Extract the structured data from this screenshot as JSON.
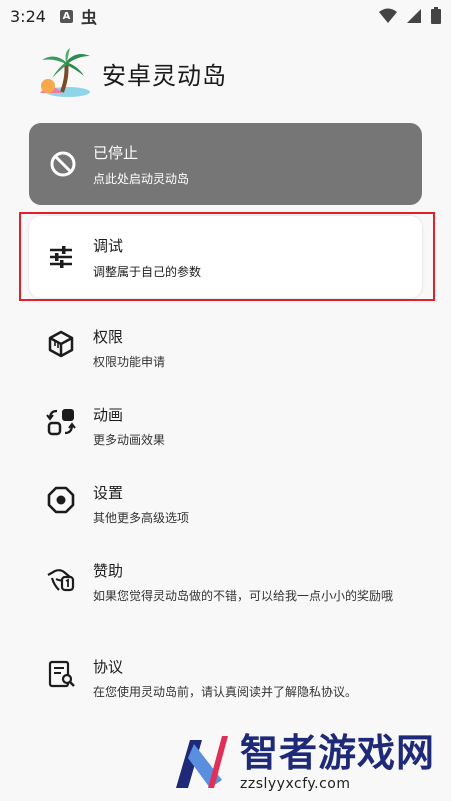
{
  "status_bar": {
    "time": "3:24",
    "notif_a": "A",
    "notif_bug": "虫"
  },
  "app": {
    "title": "安卓灵动岛"
  },
  "cards": {
    "stopped": {
      "title": "已停止",
      "subtitle": "点此处启动灵动岛"
    },
    "debug": {
      "title": "调试",
      "subtitle": "调整属于自己的参数"
    }
  },
  "menu": [
    {
      "title": "权限",
      "subtitle": "权限功能申请",
      "icon": "cube-icon"
    },
    {
      "title": "动画",
      "subtitle": "更多动画效果",
      "icon": "animation-icon"
    },
    {
      "title": "设置",
      "subtitle": "其他更多高级选项",
      "icon": "settings-icon"
    },
    {
      "title": "赞助",
      "subtitle": "如果您觉得灵动岛做的不错，可以给我一点小小的奖励哦",
      "icon": "donate-icon"
    },
    {
      "title": "协议",
      "subtitle": "在您使用灵动岛前，请认真阅读并了解隐私协议。",
      "icon": "agreement-icon"
    }
  ],
  "watermark": {
    "title": "智者游戏网",
    "url": "zzslyyxcfy.com"
  },
  "colors": {
    "stopped_card": "#767676",
    "highlight": "#e0202a",
    "watermark": "#1e2a78"
  }
}
